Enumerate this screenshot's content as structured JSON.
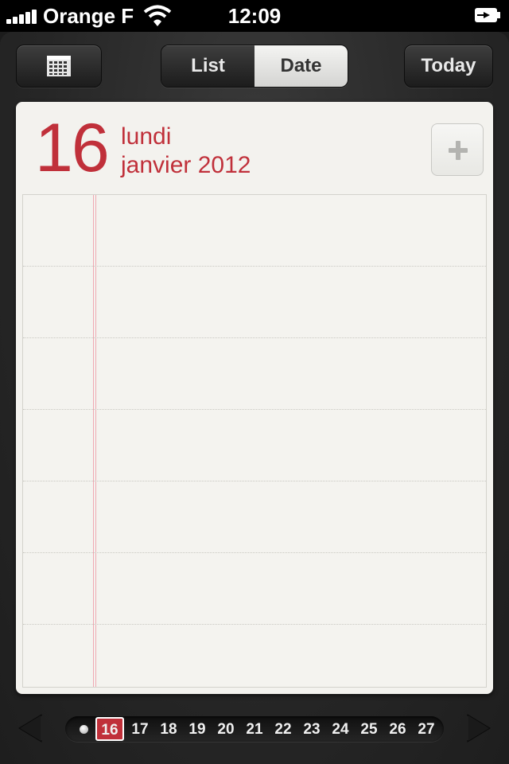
{
  "status_bar": {
    "carrier": "Orange F",
    "time": "12:09"
  },
  "toolbar": {
    "calendar_icon": "calendar-grid-icon",
    "segments": [
      {
        "label": "List",
        "selected": false
      },
      {
        "label": "Date",
        "selected": true
      }
    ],
    "today_label": "Today"
  },
  "day_view": {
    "day_number": "16",
    "day_name": "lundi",
    "month_year": "janvier 2012",
    "add_icon": "plus-icon"
  },
  "date_strip": {
    "dates": [
      "16",
      "17",
      "18",
      "19",
      "20",
      "21",
      "22",
      "23",
      "24",
      "25",
      "26",
      "27"
    ],
    "selected": "16"
  },
  "colors": {
    "accent_red": "#c0303a",
    "paper": "#f3f2ee",
    "leather": "#2a2a2a"
  }
}
